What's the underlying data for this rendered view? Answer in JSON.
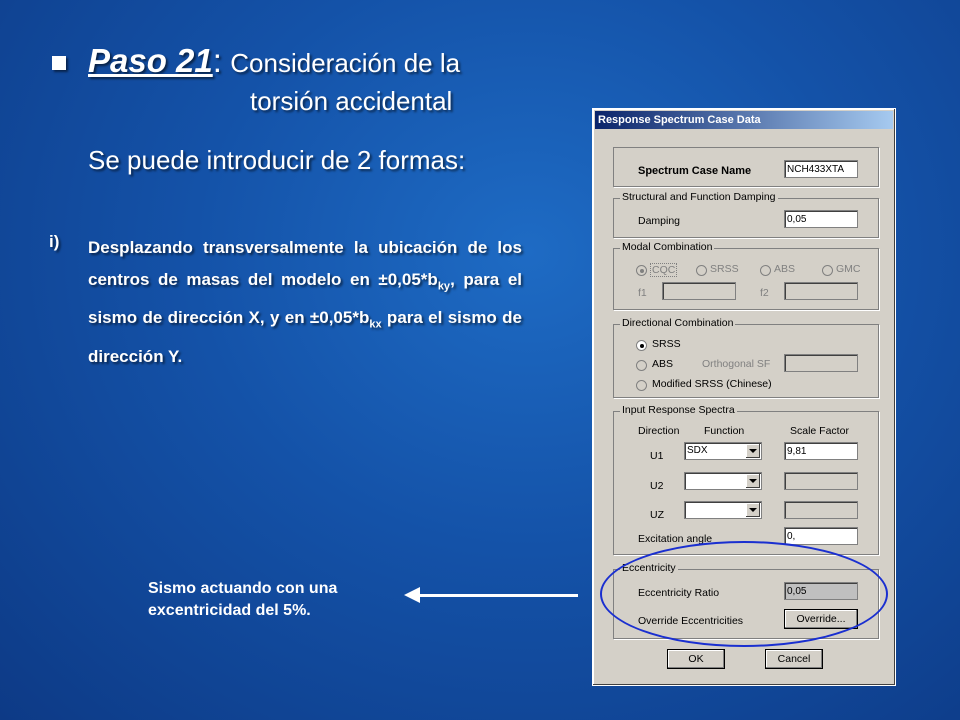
{
  "slide": {
    "title_paso": "Paso 21",
    "title_colon": ":",
    "title_rest": "Consideración de la",
    "title_line2": "torsión accidental",
    "subtitle": "Se puede introducir de 2 formas:",
    "item_marker": "i)",
    "item_part1": "Desplazando transversalmente la ubicación de los centros de masas del modelo en ±0,05*b",
    "item_sub1": "ky",
    "item_part2": ", para el sismo de dirección X, y en ±0,05*b",
    "item_sub2": "kx",
    "item_part3": " para el sismo de dirección Y.",
    "caption_line1": "Sismo actuando con una",
    "caption_line2": "excentricidad del 5%."
  },
  "dialog": {
    "title": "Response Spectrum Case Data",
    "case_name_label": "Spectrum Case Name",
    "case_name_value": "NCH433XTA",
    "damping_group": "Structural and Function Damping",
    "damping_label": "Damping",
    "damping_value": "0,05",
    "modal_group": "Modal Combination",
    "modal_options": [
      "CQC",
      "SRSS",
      "ABS",
      "GMC"
    ],
    "f1_label": "f1",
    "f2_label": "f2",
    "directional_group": "Directional Combination",
    "directional_options": [
      "SRSS",
      "ABS",
      "Modified SRSS (Chinese)"
    ],
    "orthogonal_label": "Orthogonal SF",
    "input_group": "Input Response Spectra",
    "col_direction": "Direction",
    "col_function": "Function",
    "col_scale": "Scale Factor",
    "rows": [
      {
        "dir": "U1",
        "func": "SDX",
        "scale": "9,81"
      },
      {
        "dir": "U2",
        "func": "",
        "scale": ""
      },
      {
        "dir": "UZ",
        "func": "",
        "scale": ""
      }
    ],
    "excitation_label": "Excitation angle",
    "excitation_value": "0,",
    "ecc_group": "Eccentricity",
    "ecc_ratio_label": "Eccentricity Ratio",
    "ecc_ratio_value": "0,05",
    "override_label": "Override Eccentricities",
    "override_button": "Override...",
    "ok_button": "OK",
    "cancel_button": "Cancel"
  }
}
